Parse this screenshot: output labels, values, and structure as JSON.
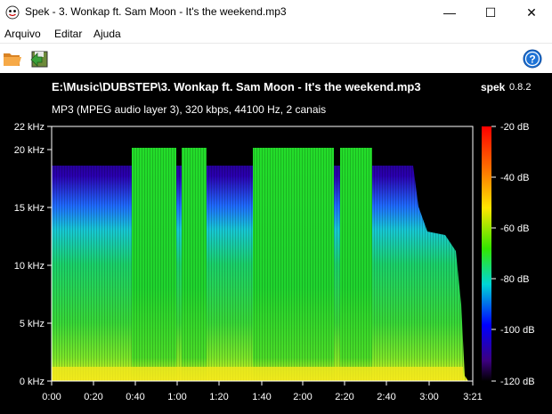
{
  "window": {
    "title": "Spek - 3. Wonkap ft. Sam Moon - It's the weekend.mp3",
    "controls": [
      "—",
      "☐",
      "✕"
    ]
  },
  "menu": [
    "Arquivo",
    "Editar",
    "Ajuda"
  ],
  "toolbar": {
    "open_icon": "folder-icon",
    "save_icon": "save-image-icon",
    "help_icon": "help-icon"
  },
  "spectrogram": {
    "file_path": "E:\\Music\\DUBSTEP\\3. Wonkap ft. Sam Moon - It's the weekend.mp3",
    "info": "MP3 (MPEG audio layer 3), 320 kbps, 44100 Hz, 2 canais",
    "app_name": "spek",
    "app_version": "0.8.2",
    "y_ticks": [
      "22 kHz",
      "20 kHz",
      "15 kHz",
      "10 kHz",
      "5 kHz",
      "0 kHz"
    ],
    "x_ticks": [
      "0:00",
      "0:20",
      "0:40",
      "1:00",
      "1:20",
      "1:40",
      "2:00",
      "2:20",
      "2:40",
      "3:00",
      "3:21"
    ],
    "db_ticks": [
      "-20 dB",
      "-40 dB",
      "-60 dB",
      "-80 dB",
      "-100 dB",
      "-120 dB"
    ]
  },
  "colors": {
    "background": "#000000",
    "spectrum_high": "#ff0000",
    "spectrum_mid": "#00ff00",
    "spectrum_low": "#0000ff",
    "help_blue": "#1e73d6",
    "folder_orange": "#f4a23a"
  }
}
